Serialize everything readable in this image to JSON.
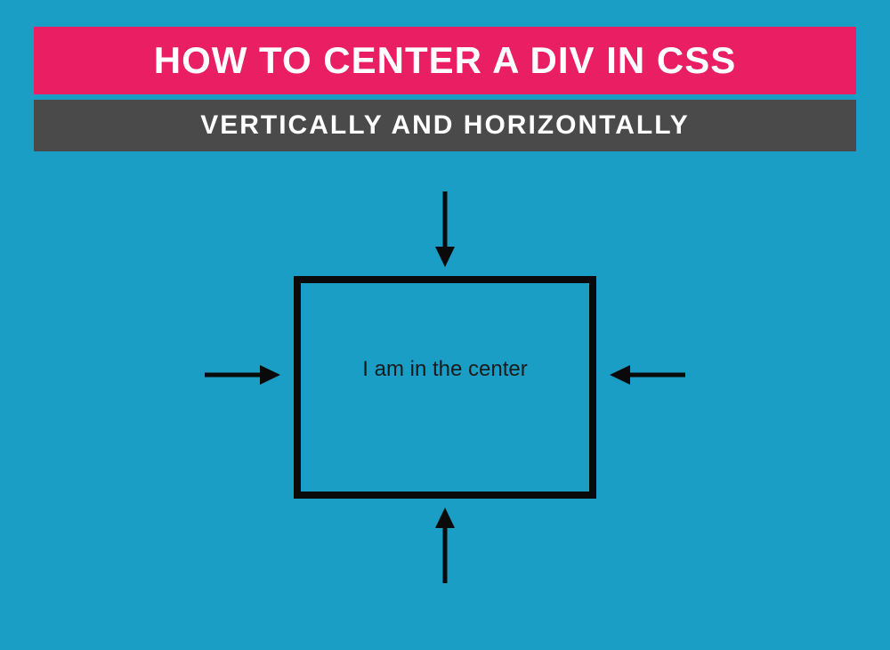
{
  "header": {
    "title": "HOW TO CENTER A DIV IN CSS",
    "subtitle": "VERTICALLY AND HORIZONTALLY"
  },
  "diagram": {
    "box_text": "I am in the center"
  },
  "colors": {
    "background": "#1a9ec5",
    "title_bg": "#e91e63",
    "subtitle_bg": "#4a4a4a",
    "text_light": "#ffffff",
    "box_border": "#0a0a0a",
    "box_text": "#1a1a1a"
  }
}
